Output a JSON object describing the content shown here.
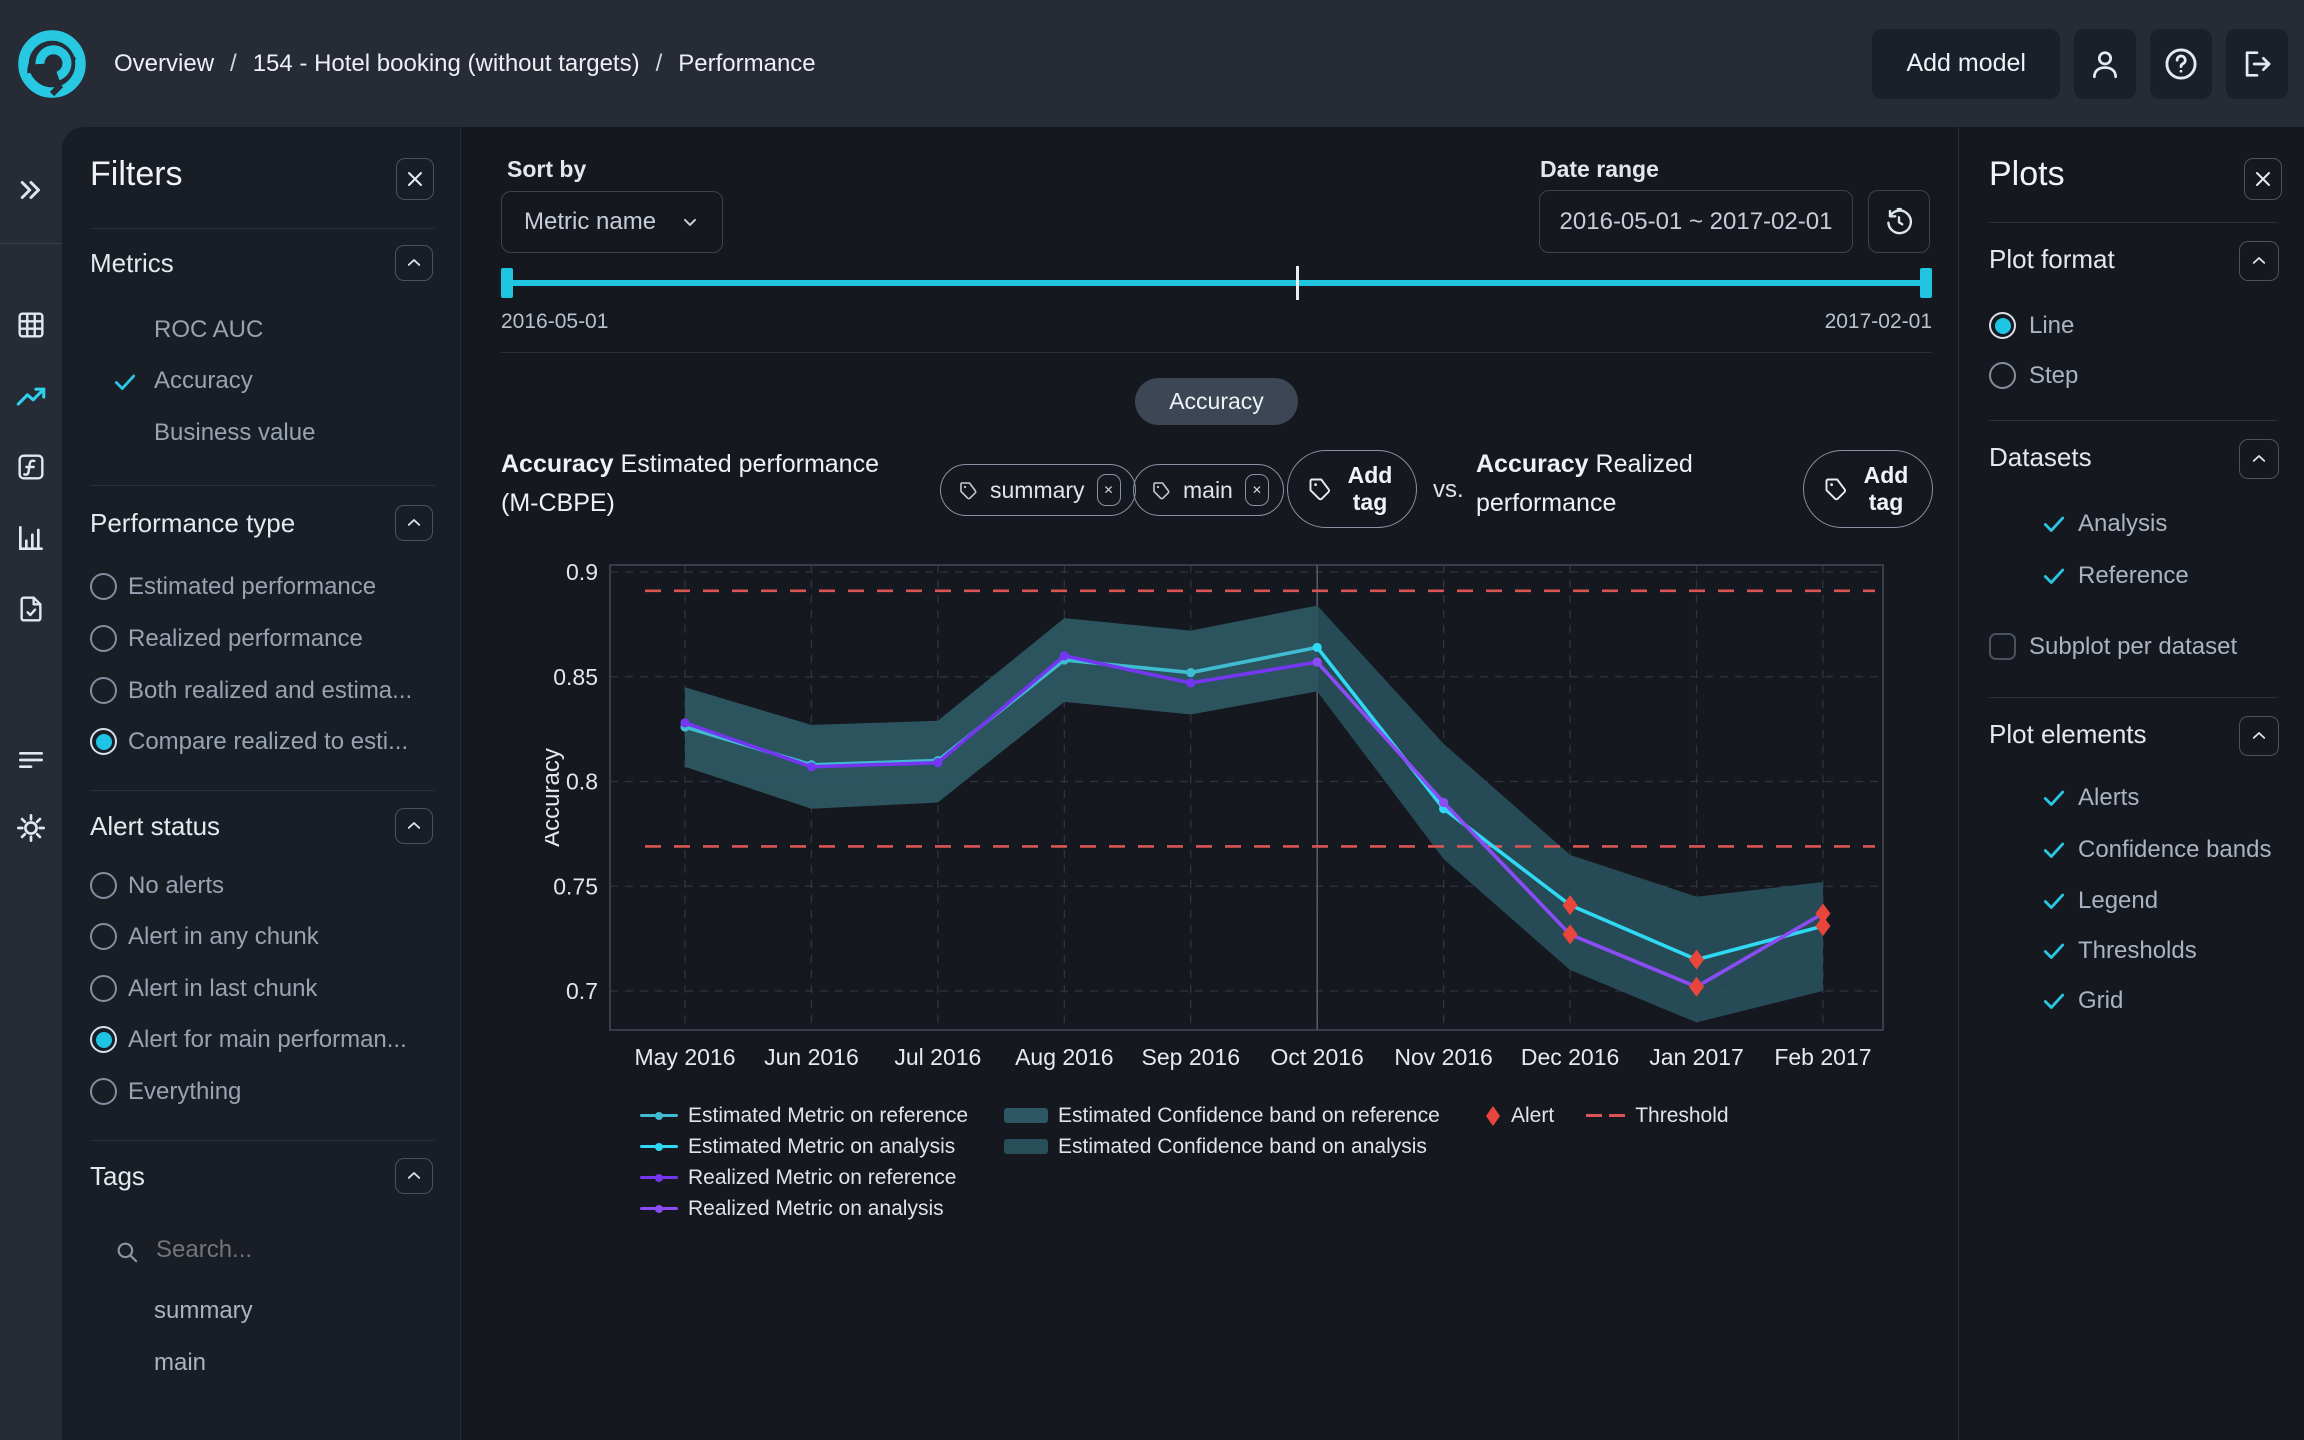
{
  "header": {
    "breadcrumb": [
      "Overview",
      "154 - Hotel booking (without targets)",
      "Performance"
    ],
    "breadcrumb_separator": "/",
    "add_model_label": "Add model"
  },
  "icons": {
    "logo": "nannyml-logo",
    "user": "user-icon",
    "help": "help-icon",
    "logout": "logout-icon",
    "expand": "chevrons-right-icon",
    "table": "table-icon",
    "trend": "trending-up-icon",
    "function": "function-icon",
    "barchart": "bar-chart-icon",
    "doc_check": "document-check-icon",
    "menu": "menu-lines-icon",
    "gear": "gear-icon",
    "search": "search-icon",
    "tag": "tag-icon",
    "history": "history-reset-icon",
    "close": "close-icon",
    "chevron_up": "chevron-up-icon",
    "chevron_down": "chevron-down-icon",
    "check": "check-icon"
  },
  "colors": {
    "accent_cyan": "#1fc5e0",
    "header_bg": "#262b35",
    "panel_bg": "#191d25",
    "body_bg": "#15181e",
    "alert_red": "#e8463d",
    "threshold_red": "#d95555"
  },
  "filters": {
    "title": "Filters",
    "metrics": {
      "title": "Metrics",
      "items": [
        {
          "label": "ROC AUC",
          "checked": false
        },
        {
          "label": "Accuracy",
          "checked": true
        },
        {
          "label": "Business value",
          "checked": false
        }
      ]
    },
    "performance_type": {
      "title": "Performance type",
      "options": [
        {
          "label": "Estimated performance",
          "selected": false
        },
        {
          "label": "Realized performance",
          "selected": false
        },
        {
          "label": "Both realized and estima...",
          "selected": false
        },
        {
          "label": "Compare realized to esti...",
          "selected": true
        }
      ]
    },
    "alert_status": {
      "title": "Alert status",
      "options": [
        {
          "label": "No alerts",
          "selected": false
        },
        {
          "label": "Alert in any chunk",
          "selected": false
        },
        {
          "label": "Alert in last chunk",
          "selected": false
        },
        {
          "label": "Alert for main performan...",
          "selected": true
        },
        {
          "label": "Everything",
          "selected": false
        }
      ]
    },
    "tags": {
      "title": "Tags",
      "search_placeholder": "Search...",
      "items": [
        "summary",
        "main"
      ]
    }
  },
  "toolbar": {
    "sort_by_label": "Sort by",
    "sort_value": "Metric name",
    "date_range_label": "Date range",
    "date_range_value": "2016-05-01 ~ 2017-02-01",
    "slider_start": "2016-05-01",
    "slider_end": "2017-02-01",
    "metric_pill": "Accuracy"
  },
  "chart_header": {
    "left_metric": "Accuracy",
    "left_title": "Estimated performance (M-CBPE)",
    "tags": [
      "summary",
      "main"
    ],
    "add_tag_label_1": "Add",
    "add_tag_label_2": "tag",
    "vs_label": "vs.",
    "right_metric": "Accuracy",
    "right_title": "Realized performance"
  },
  "chart_data": {
    "type": "line",
    "title": "Accuracy Estimated performance (M-CBPE) vs. Accuracy Realized performance",
    "ylabel": "Accuracy",
    "xlabel": "",
    "x_categories": [
      "May 2016",
      "Jun 2016",
      "Jul 2016",
      "Aug 2016",
      "Sep 2016",
      "Oct 2016",
      "Nov 2016",
      "Dec 2016",
      "Jan 2017",
      "Feb 2017"
    ],
    "y_ticks": [
      0.9,
      0.85,
      0.8,
      0.75,
      0.7
    ],
    "ylim": [
      0.68,
      0.905
    ],
    "grid": true,
    "legend_position": "bottom",
    "reference_analysis_split_index": 5,
    "series": [
      {
        "name": "Estimated Metric",
        "values": [
          0.826,
          0.808,
          0.81,
          0.858,
          0.852,
          0.864,
          0.787,
          0.741,
          0.715,
          0.731
        ],
        "color_reference": "#3fbcd2",
        "color_analysis": "#2fd8f3"
      },
      {
        "name": "Realized Metric",
        "values": [
          0.828,
          0.807,
          0.809,
          0.86,
          0.847,
          0.857,
          0.79,
          0.727,
          0.702,
          0.737
        ],
        "color_reference": "#7436f0",
        "color_analysis": "#8b4cf6"
      }
    ],
    "confidence_band": {
      "upper": [
        0.845,
        0.827,
        0.829,
        0.878,
        0.872,
        0.884,
        0.818,
        0.765,
        0.745,
        0.752
      ],
      "lower": [
        0.807,
        0.787,
        0.79,
        0.838,
        0.832,
        0.843,
        0.763,
        0.71,
        0.685,
        0.7
      ],
      "color_reference": "#2c5763",
      "color_analysis": "#284e5a"
    },
    "thresholds": {
      "upper": 0.891,
      "lower": 0.769,
      "color": "#d95555"
    },
    "alert_color": "#e8463d",
    "alerts": [
      {
        "series": 0,
        "index": 7
      },
      {
        "series": 0,
        "index": 8
      },
      {
        "series": 0,
        "index": 9
      },
      {
        "series": 1,
        "index": 7
      },
      {
        "series": 1,
        "index": 8
      },
      {
        "series": 1,
        "index": 9
      }
    ],
    "legend": [
      "Estimated Metric on reference",
      "Estimated Metric on analysis",
      "Realized Metric on reference",
      "Realized Metric on analysis",
      "Estimated Confidence band on reference",
      "Estimated Confidence band on analysis",
      "Alert",
      "Threshold"
    ]
  },
  "plots": {
    "title": "Plots",
    "plot_format": {
      "title": "Plot format",
      "options": [
        {
          "label": "Line",
          "selected": true
        },
        {
          "label": "Step",
          "selected": false
        }
      ]
    },
    "datasets": {
      "title": "Datasets",
      "items": [
        {
          "label": "Analysis",
          "checked": true
        },
        {
          "label": "Reference",
          "checked": true
        }
      ],
      "subplot_label": "Subplot per dataset",
      "subplot_checked": false
    },
    "plot_elements": {
      "title": "Plot elements",
      "items": [
        {
          "label": "Alerts",
          "checked": true
        },
        {
          "label": "Confidence bands",
          "checked": true
        },
        {
          "label": "Legend",
          "checked": true
        },
        {
          "label": "Thresholds",
          "checked": true
        },
        {
          "label": "Grid",
          "checked": true
        }
      ]
    }
  }
}
